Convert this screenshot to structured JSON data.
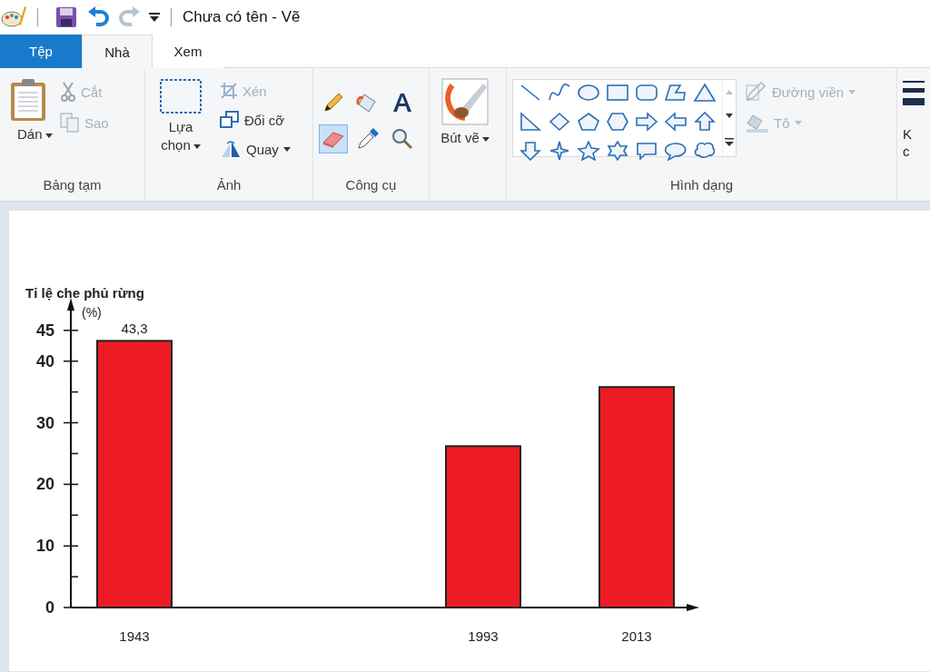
{
  "window": {
    "title": "Chưa có tên - Vẽ"
  },
  "tabs": [
    {
      "label": "Tệp",
      "selected": false,
      "kind": "file"
    },
    {
      "label": "Nhà",
      "selected": true,
      "kind": "tab"
    },
    {
      "label": "Xem",
      "selected": false,
      "kind": "tab"
    }
  ],
  "ribbon": {
    "groups": [
      {
        "title": "Bảng tạm",
        "items": [
          {
            "kind": "large",
            "label": "Dán",
            "dropdown": true,
            "disabled": false
          },
          {
            "kind": "small",
            "label": "Cắt",
            "dropdown": false,
            "disabled": true
          },
          {
            "kind": "small",
            "label": "Sao",
            "dropdown": false,
            "disabled": true
          }
        ]
      },
      {
        "title": "Ảnh",
        "items": [
          {
            "kind": "large",
            "label": "Lựa chọn",
            "dropdown": true,
            "disabled": false
          },
          {
            "kind": "small",
            "label": "Xén",
            "dropdown": false,
            "disabled": true
          },
          {
            "kind": "small",
            "label": "Đổi cỡ",
            "dropdown": false,
            "disabled": false
          },
          {
            "kind": "small",
            "label": "Quay",
            "dropdown": true,
            "disabled": false
          }
        ]
      },
      {
        "title": "Công cụ",
        "items": [
          {
            "kind": "tool",
            "selected": false
          },
          {
            "kind": "tool",
            "selected": false
          },
          {
            "kind": "tool",
            "selected": false
          },
          {
            "kind": "tool",
            "selected": true
          },
          {
            "kind": "tool",
            "selected": false
          },
          {
            "kind": "tool",
            "selected": false
          }
        ]
      },
      {
        "items": [
          {
            "kind": "large",
            "label": "Bút vẽ",
            "dropdown": true,
            "disabled": false
          }
        ]
      },
      {
        "title": "Hình dạng",
        "items": [
          {
            "kind": "gallery"
          },
          {
            "kind": "small",
            "label": "Đường viền",
            "dropdown": true,
            "disabled": true
          },
          {
            "kind": "small",
            "label": "Tô",
            "dropdown": true,
            "disabled": true
          }
        ]
      },
      {
        "items": [
          {
            "kind": "cut",
            "lines": [
              "K",
              "c"
            ]
          }
        ]
      }
    ]
  },
  "canvas": {
    "chart_data": {
      "type": "bar",
      "ylabel": "Tỉ lệ che phủ rừng",
      "annotations": [
        {
          "text": "(%)"
        }
      ],
      "categories": [
        "1943",
        "1993",
        "2013"
      ],
      "values": [
        43.3,
        26.2,
        35.8
      ],
      "ylim": [
        0,
        49.1
      ],
      "yticks": [
        0,
        10,
        20,
        30,
        40,
        45
      ],
      "value_labels": [
        "43,3",
        null,
        null
      ]
    }
  }
}
